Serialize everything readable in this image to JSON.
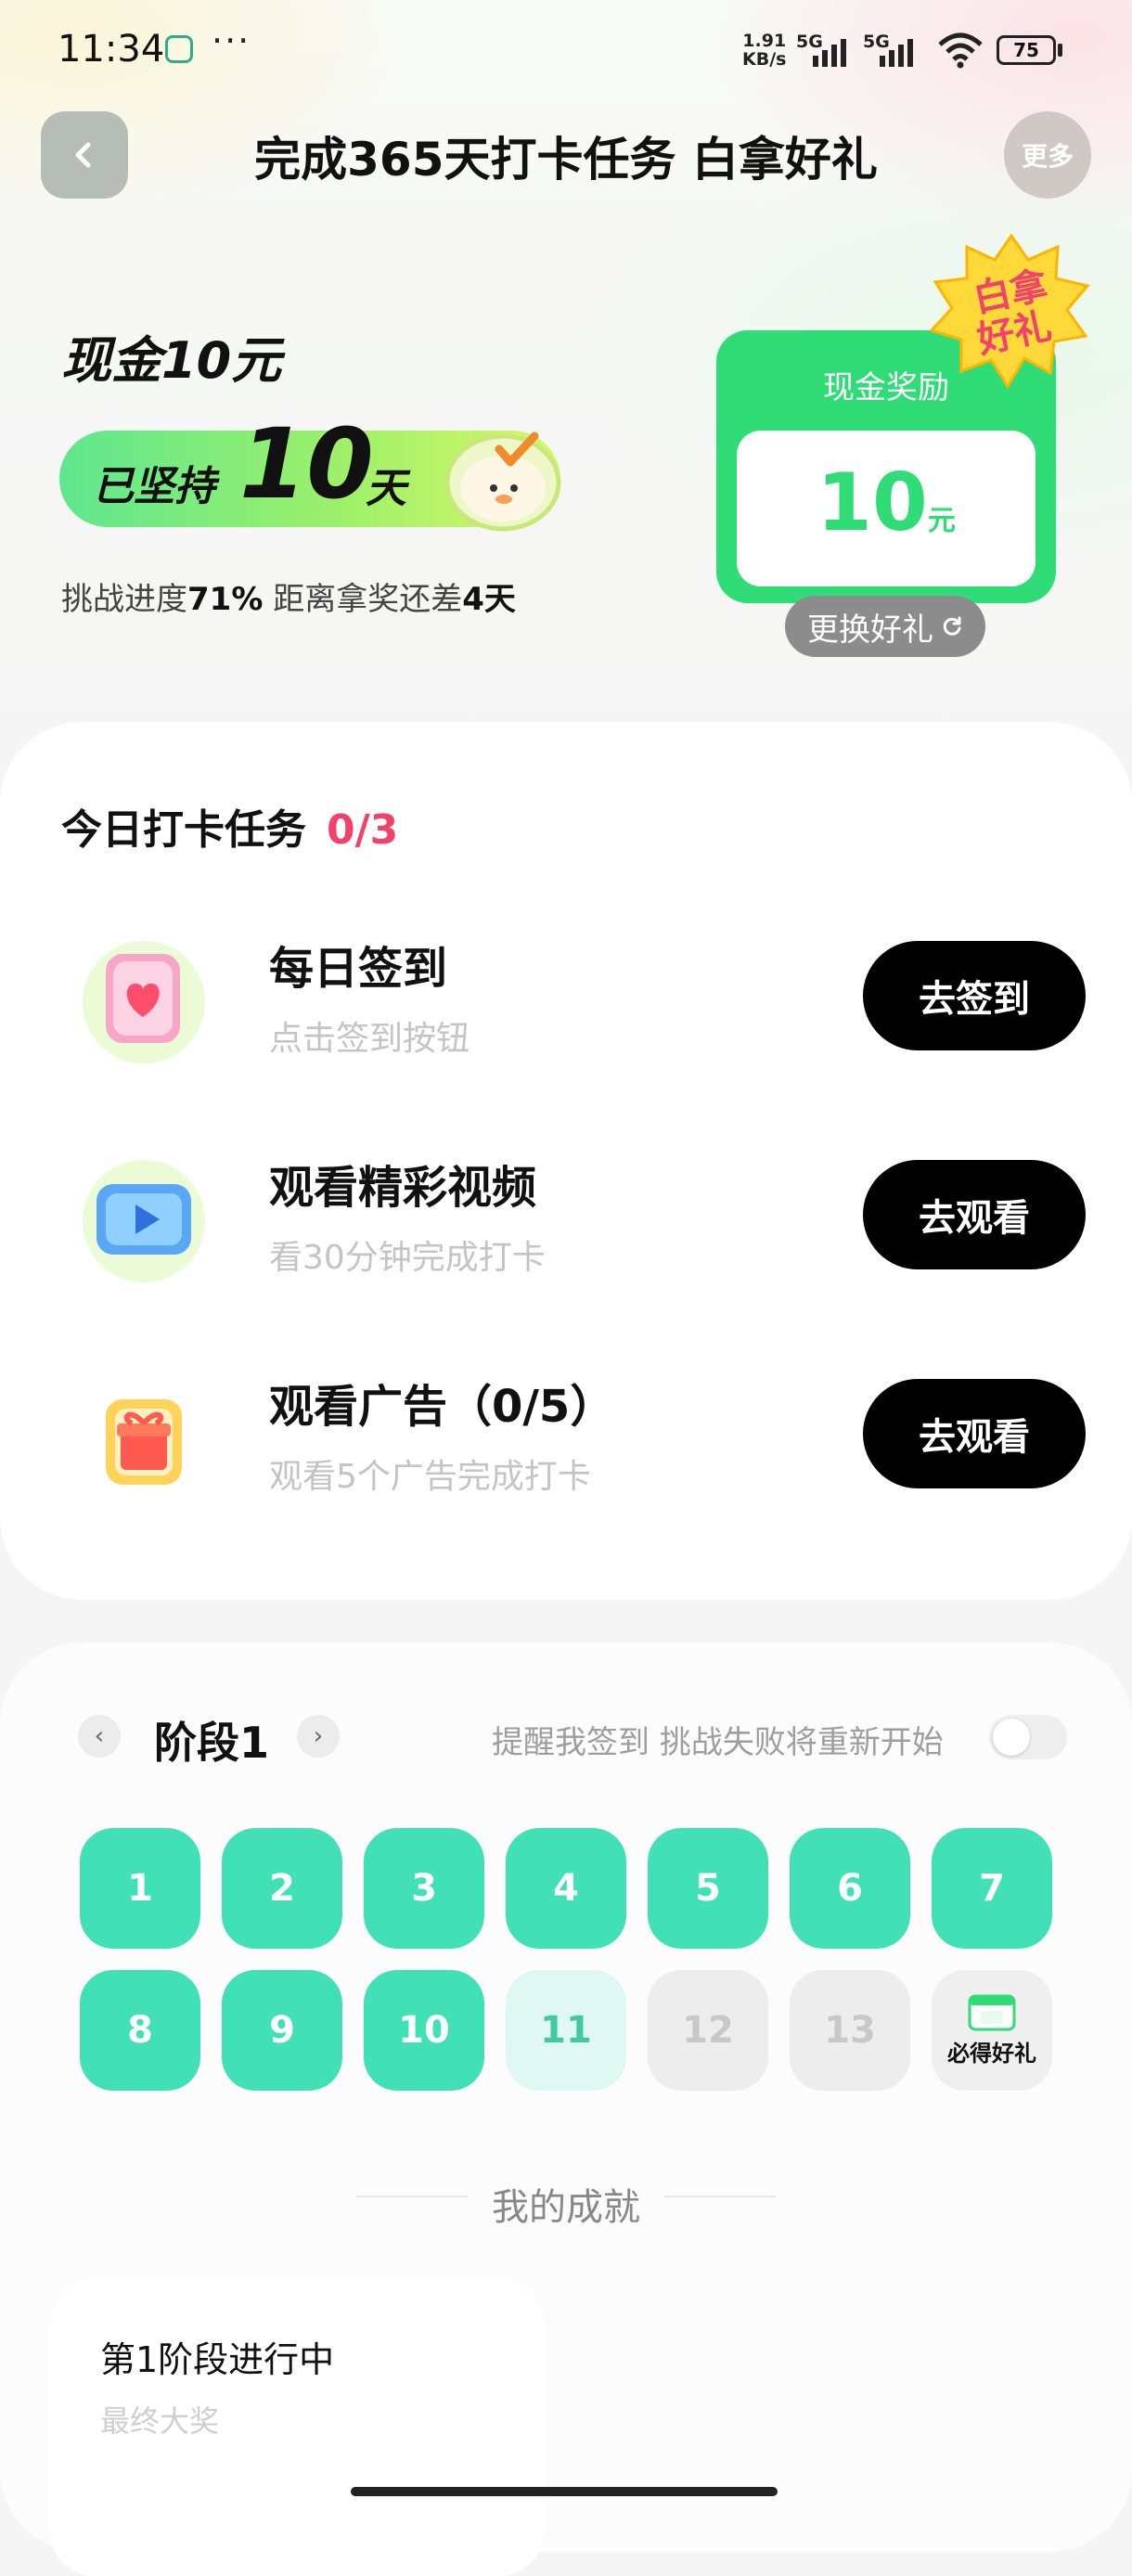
{
  "status_bar": {
    "time": "11:34",
    "more_dots": "···",
    "net_speed_value": "1.91",
    "net_speed_unit": "KB/s",
    "sim1": "5G",
    "sim2": "5G",
    "battery": "75"
  },
  "header": {
    "title": "完成365天打卡任务 白拿好礼",
    "more_label": "更多"
  },
  "summary": {
    "cash_title": "现金10元",
    "streak_prefix": "已坚持",
    "streak_days": "10",
    "streak_suffix": "天",
    "progress_prefix": "挑战进度",
    "progress_percent": "71%",
    "progress_middle": " 距离拿奖还差",
    "progress_remaining": "4天",
    "progress_fraction": 0.71
  },
  "reward": {
    "label": "现金奖励",
    "amount": "10",
    "unit": "元",
    "badge_line1": "白拿",
    "badge_line2": "好礼",
    "swap_label": "更换好礼"
  },
  "tasks": {
    "heading": "今日打卡任务",
    "count": "0/3",
    "items": [
      {
        "title": "每日签到",
        "subtitle": "点击签到按钮",
        "button": "去签到"
      },
      {
        "title": "观看精彩视频",
        "subtitle": "看30分钟完成打卡",
        "button": "去观看"
      },
      {
        "title": "观看广告（0/5）",
        "subtitle": "观看5个广告完成打卡",
        "button": "去观看"
      }
    ]
  },
  "stage": {
    "title": "阶段1",
    "remind_text": "提醒我签到 挑战失败将重新开始",
    "reminder_enabled": false,
    "days": [
      {
        "label": "1",
        "state": "done"
      },
      {
        "label": "2",
        "state": "done"
      },
      {
        "label": "3",
        "state": "done"
      },
      {
        "label": "4",
        "state": "done"
      },
      {
        "label": "5",
        "state": "done"
      },
      {
        "label": "6",
        "state": "done"
      },
      {
        "label": "7",
        "state": "done"
      },
      {
        "label": "8",
        "state": "done"
      },
      {
        "label": "9",
        "state": "done"
      },
      {
        "label": "10",
        "state": "done"
      },
      {
        "label": "11",
        "state": "today"
      },
      {
        "label": "12",
        "state": "future"
      },
      {
        "label": "13",
        "state": "future"
      }
    ],
    "gift_label": "必得好礼"
  },
  "achievements": {
    "title": "我的成就",
    "card_title": "第1阶段进行中",
    "card_subtitle": "最终大奖"
  },
  "colors": {
    "accent_green": "#2fdc76",
    "day_done": "#42e0b6",
    "count_pink": "#f2416b"
  }
}
